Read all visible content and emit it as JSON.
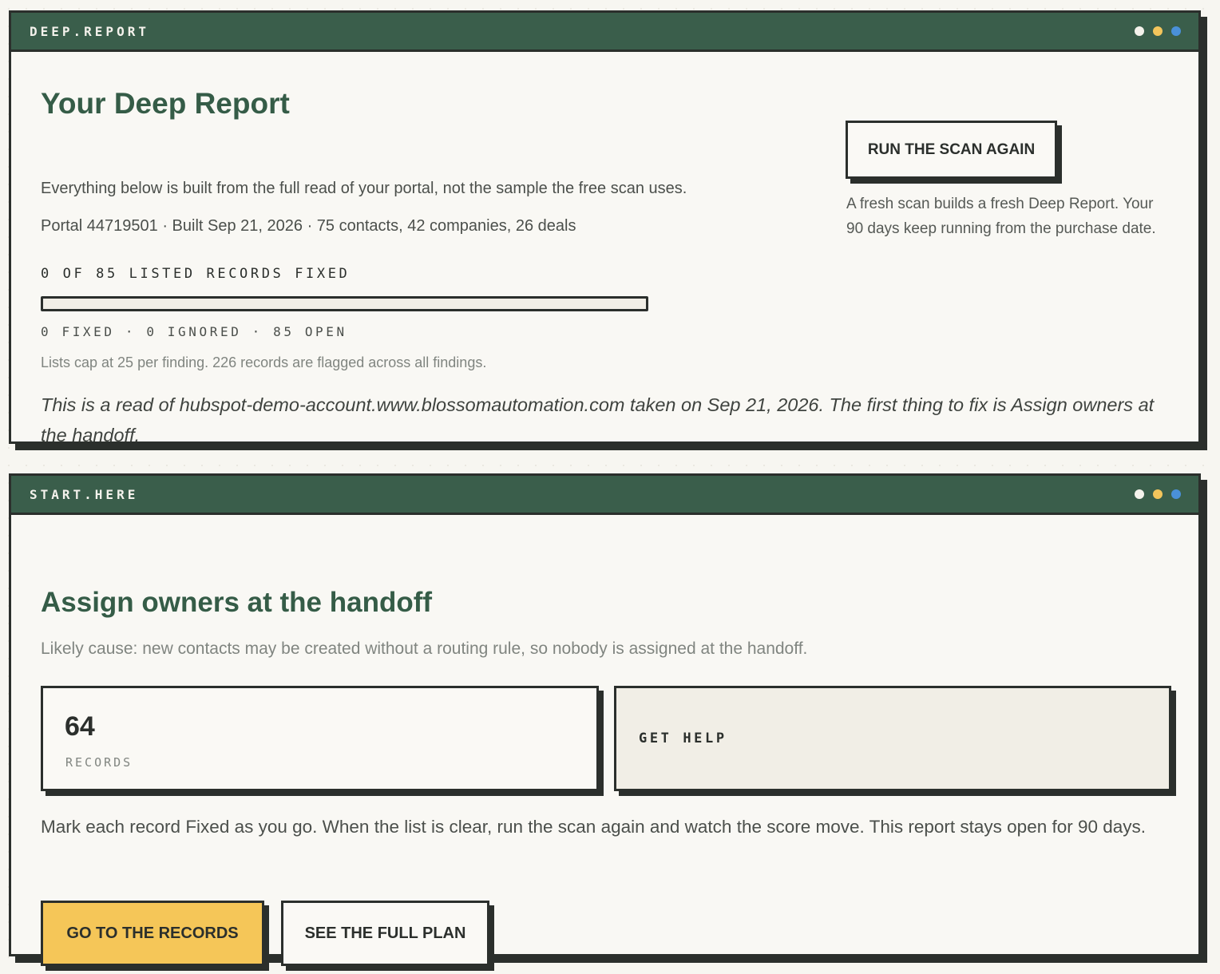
{
  "report_panel": {
    "window_label": "DEEP.REPORT",
    "title": "Your Deep Report",
    "subtitle": "Everything below is built from the full read of your portal, not the sample the free scan uses.",
    "meta": "Portal 44719501 · Built Sep 21, 2026 · 75 contacts, 42 companies, 26 deals",
    "progress_label": "0 OF 85 LISTED RECORDS FIXED",
    "progress_fraction": 0,
    "counts": "0 FIXED · 0 IGNORED · 85 OPEN",
    "cap_note": "Lists cap at 25 per finding. 226 records are flagged across all findings.",
    "summary": "This is a read of hubspot-demo-account.www.blossomautomation.com taken on Sep 21, 2026. The first thing to fix is Assign owners at the handoff.",
    "rescan_button": "RUN THE SCAN AGAIN",
    "rescan_note": "A fresh scan builds a fresh Deep Report. Your 90 days keep running from the purchase date."
  },
  "start_panel": {
    "window_label": "START.HERE",
    "title": "Assign owners at the handoff",
    "cause": "Likely cause: new contacts may be created without a routing rule, so nobody is assigned at the handoff.",
    "records_count": "64",
    "records_label": "RECORDS",
    "help_label": "GET HELP",
    "instructions": "Mark each record Fixed as you go. When the list is clear, run the scan again and watch the score move. This report stays open for 90 days.",
    "primary_button": "GO TO THE RECORDS",
    "secondary_button": "SEE THE FULL PLAN"
  },
  "colors": {
    "brand_green": "#3a5e4b",
    "accent_yellow": "#f5c658",
    "ink": "#2b2f2c",
    "paper": "#f9f8f4"
  }
}
